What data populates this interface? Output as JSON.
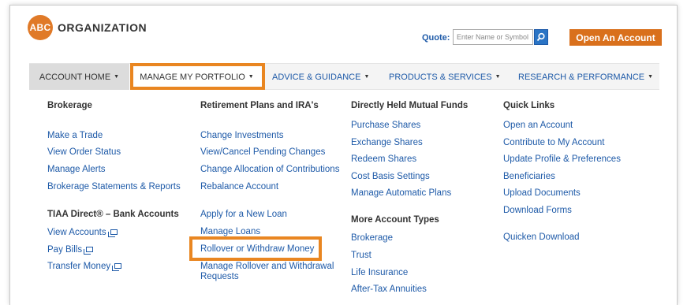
{
  "header": {
    "logo_mark": "ABC",
    "logo_text": "ORGANIZATION",
    "quote_label": "Quote:",
    "quote_placeholder": "Enter Name or Symbol",
    "open_account_label": "Open An Account"
  },
  "nav": {
    "items": [
      {
        "label": "ACCOUNT HOME",
        "arrow": "▼"
      },
      {
        "label": "MANAGE MY PORTFOLIO",
        "arrow": "▼"
      },
      {
        "label": "ADVICE & GUIDANCE",
        "arrow": "▼"
      },
      {
        "label": "PRODUCTS & SERVICES",
        "arrow": "▼"
      },
      {
        "label": "RESEARCH & PERFORMANCE",
        "arrow": "▼"
      }
    ]
  },
  "menu": {
    "brokerage": {
      "heading": "Brokerage",
      "links": [
        "Make a Trade",
        "View Order Status",
        "Manage Alerts",
        "Brokerage Statements & Reports"
      ],
      "bank_heading": "TIAA Direct® – Bank Accounts",
      "bank_links": [
        "View Accounts",
        "Pay Bills",
        "Transfer Money"
      ]
    },
    "retirement": {
      "heading": "Retirement Plans and IRA's",
      "links": [
        "Change Investments",
        "View/Cancel Pending Changes",
        "Change Allocation of Contributions",
        "Rebalance Account"
      ],
      "loan_links": [
        "Apply for a New Loan",
        "Manage Loans",
        "Rollover or Withdraw Money",
        "Manage Rollover and Withdrawal Requests"
      ]
    },
    "mutual_funds": {
      "heading": "Directly Held Mutual Funds",
      "links": [
        "Purchase Shares",
        "Exchange Shares",
        "Redeem Shares",
        "Cost Basis Settings",
        "Manage Automatic Plans"
      ],
      "more_heading": "More Account Types",
      "more_links": [
        "Brokerage",
        "Trust",
        "Life Insurance",
        "After-Tax Annuities"
      ]
    },
    "quick_links": {
      "heading": "Quick Links",
      "links": [
        "Open an Account",
        "Contribute to My Account",
        "Update Profile & Preferences",
        "Beneficiaries",
        "Upload Documents",
        "Download Forms",
        "Quicken Download"
      ]
    }
  },
  "colors": {
    "accent": "#d9701c",
    "highlight": "#e98621",
    "link": "#1e5aa8"
  }
}
